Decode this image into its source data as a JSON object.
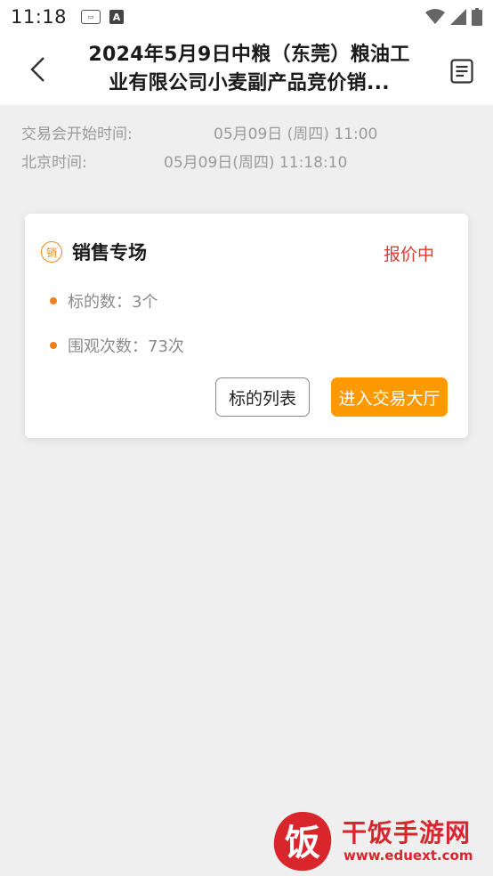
{
  "status_bar": {
    "time": "11:18"
  },
  "header": {
    "title": "2024年5月9日中粮（东莞）粮油工业有限公司小麦副产品竞价销..."
  },
  "info": {
    "start_label": "交易会开始时间:",
    "start_value": "05月09日 (周四) 11:00",
    "beijing_label": "北京时间:",
    "beijing_value": "05月09日(周四) 11:18:10"
  },
  "card": {
    "badge": "销",
    "title": "销售专场",
    "status": "报价中",
    "lot_count": "标的数：3个",
    "view_count": "围观次数：73次",
    "list_button": "标的列表",
    "enter_button": "进入交易大厅"
  },
  "watermark": {
    "logo_char": "饭",
    "name": "干饭手游网",
    "url": "www.eduext.com"
  },
  "colors": {
    "accent": "#ff9900",
    "status_red": "#e03a2f",
    "bullet": "#f07f1d"
  }
}
